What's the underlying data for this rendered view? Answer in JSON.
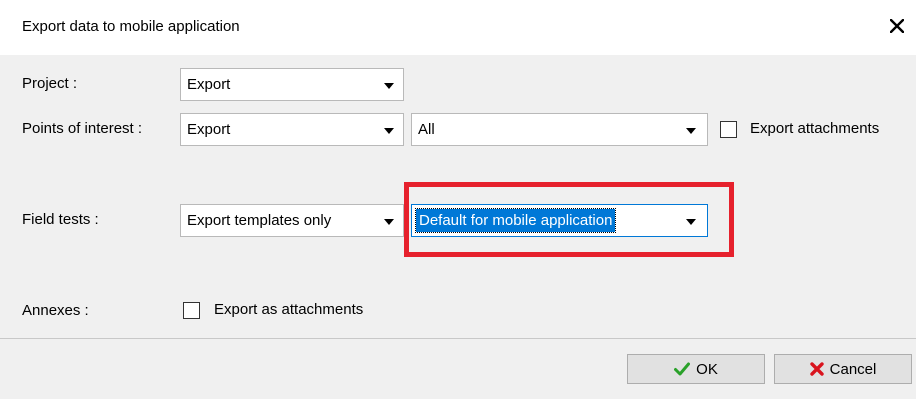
{
  "dialog": {
    "title": "Export data to mobile application"
  },
  "project": {
    "label": "Project :",
    "value": "Export"
  },
  "points_of_interest": {
    "label": "Points of interest :",
    "value": "Export",
    "filter_value": "All",
    "attachments_label": "Export attachments",
    "attachments_checked": false
  },
  "field_tests": {
    "label": "Field tests :",
    "value": "Export templates only",
    "template_value": "Default for mobile application"
  },
  "annexes": {
    "label": "Annexes :",
    "checkbox_label": "Export as attachments",
    "checked": false
  },
  "buttons": {
    "ok_label": "OK",
    "cancel_label": "Cancel"
  },
  "colors": {
    "highlight": "#e6212d",
    "selection": "#0078d7",
    "ok_icon": "#2aa12a",
    "cancel_icon": "#d9141e"
  },
  "icons": {
    "close": "close-icon",
    "ok": "checkmark-icon",
    "cancel": "x-icon",
    "dropdown": "chevron-down-icon"
  }
}
